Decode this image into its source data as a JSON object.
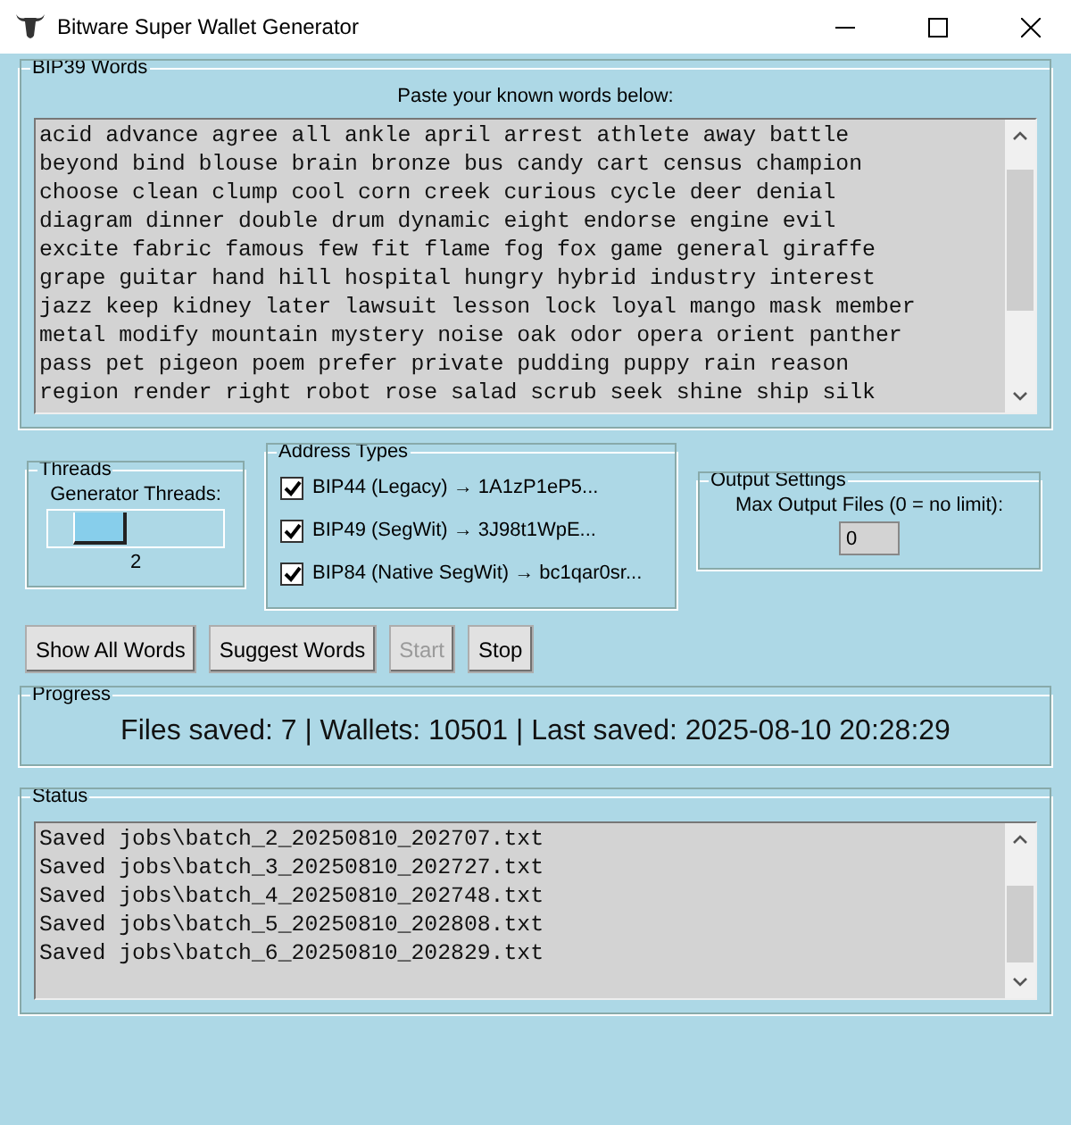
{
  "window": {
    "title": "Bitware Super Wallet Generator"
  },
  "bip39": {
    "title": "BIP39 Words",
    "instruction": "Paste your known words below:",
    "lines": [
      "acid advance agree all ankle april arrest athlete away battle",
      "beyond bind blouse brain bronze bus candy cart census champion",
      "choose clean clump cool corn creek curious cycle deer denial",
      "diagram dinner double drum dynamic eight endorse engine evil",
      "excite fabric famous few fit flame fog fox game general giraffe",
      "grape guitar hand hill hospital hungry hybrid industry interest",
      "jazz keep kidney later lawsuit lesson lock loyal mango mask member",
      "metal modify mountain mystery noise oak odor opera orient panther",
      "pass pet pigeon poem prefer private pudding puppy rain reason",
      "region render right robot rose salad scrub seek shine ship silk"
    ]
  },
  "threads": {
    "title": "Threads",
    "label": "Generator Threads:",
    "level": 0.2,
    "reading": "2"
  },
  "address_types": {
    "title": "Address Types",
    "items": [
      {
        "label": "BIP44 (Legacy) → 1A1zP1eP5...",
        "checked": true
      },
      {
        "label": "BIP49 (SegWit) → 3J98t1WpE...",
        "checked": true
      },
      {
        "label": "BIP84 (Native SegWit) → bc1qar0sr...",
        "checked": true
      }
    ]
  },
  "output_settings": {
    "title": "Output Settings",
    "label": "Max Output Files (0 = no limit):",
    "value": "0"
  },
  "buttons": [
    {
      "label": "Show All Words",
      "disabled": false
    },
    {
      "label": "Suggest Words",
      "disabled": false
    },
    {
      "label": "Start",
      "disabled": true
    },
    {
      "label": "Stop",
      "disabled": false
    }
  ],
  "progress": {
    "title": "Progress",
    "text": "Files saved: 7 | Wallets: 10501 | Last saved: 2025-08-10 20:28:29"
  },
  "status": {
    "title": "Status",
    "lines": [
      "Saved jobs\\batch_2_20250810_202707.txt",
      "Saved jobs\\batch_3_20250810_202727.txt",
      "Saved jobs\\batch_4_20250810_202748.txt",
      "Saved jobs\\batch_5_20250810_202808.txt",
      "Saved jobs\\batch_6_20250810_202829.txt"
    ]
  }
}
